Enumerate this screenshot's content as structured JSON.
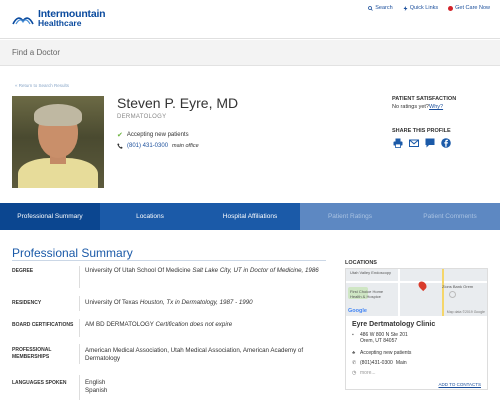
{
  "brand": {
    "line1": "Intermountain",
    "line2": "Healthcare"
  },
  "top_links": {
    "search": "Search",
    "quick_links": "Quick Links",
    "get_care": "Get Care Now"
  },
  "subbar": {
    "title": "Find a Doctor"
  },
  "return_link": "« Return to Search Results",
  "doctor": {
    "name": "Steven P. Eyre, MD",
    "specialty": "DERMATOLOGY",
    "accepting": "Accepting new patients",
    "phone": "(801) 431-0300",
    "phone_type": "main office"
  },
  "patient_satisfaction": {
    "heading": "PATIENT SATISFACTION",
    "text": "No ratings yet?",
    "why": "Why?"
  },
  "share": {
    "heading": "SHARE THIS PROFILE",
    "icons": [
      "print-icon",
      "email-icon",
      "chat-icon",
      "facebook-icon"
    ]
  },
  "tabs": [
    "Professional Summary",
    "Locations",
    "Hospital Affiliations",
    "Patient Ratings",
    "Patient Comments"
  ],
  "summary": {
    "title": "Professional Summary",
    "rows": [
      {
        "label": "DEGREE",
        "value": "University Of Utah School Of Medicine",
        "detail": "Salt Lake City, UT in Doctor of Medicine, 1986"
      },
      {
        "label": "RESIDENCY",
        "value": "University Of Texas",
        "detail": "Houston, Tx in Dermatology, 1987 - 1990"
      },
      {
        "label": "BOARD CERTIFICATIONS",
        "value": "AM BD DERMATOLOGY",
        "detail": "Certification does not expire"
      },
      {
        "label": "PROFESSIONAL MEMBERSHIPS",
        "value": "American Medical Association, Utah Medical Association, American Academy of Dermatology",
        "detail": ""
      },
      {
        "label": "LANGUAGES SPOKEN",
        "value": "English",
        "detail": "Spanish"
      }
    ]
  },
  "locations": {
    "heading": "LOCATIONS",
    "map": {
      "label_top": "Utah Valley Endoscopy",
      "label_bank": "Zions Bank Orem",
      "label_first": "First Choice Home",
      "label_first2": "Health & Hospice",
      "google": "Google",
      "copyright": "Map data ©2019 Google"
    },
    "clinic": {
      "name": "Eyre Dertmatology Clinic",
      "address1": "486 W 800 N Ste 201",
      "address2": "Orem, UT 84057",
      "accepting": "Accepting new patients",
      "phone": "(801)431-0300",
      "phone_type": "Main",
      "more": "more...",
      "add_contacts": "ADD TO CONTACTS"
    }
  },
  "colors": {
    "brand_blue": "#1b5aa8",
    "tab_active": "#0b4690",
    "tab_disabled": "#5d88c2",
    "accept_green": "#6cb33f",
    "care_red": "#d2232a"
  }
}
